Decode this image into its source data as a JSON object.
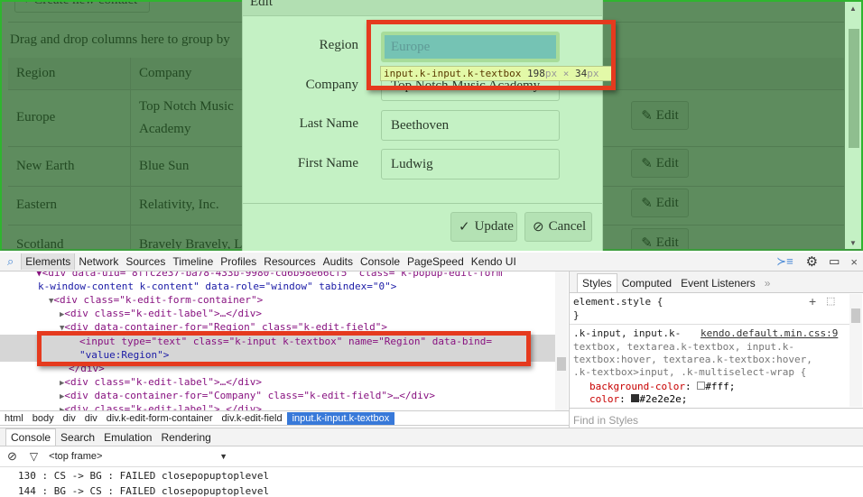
{
  "page": {
    "create_button": "Create new contact",
    "group_hint": "Drag and drop columns here to group by",
    "columns": [
      "Region",
      "Company"
    ],
    "rows": [
      {
        "region": "Europe",
        "company": "Top Notch Music Academy",
        "edit": "Edit"
      },
      {
        "region": "New Earth",
        "company": "Blue Sun",
        "edit": "Edit"
      },
      {
        "region": "Eastern",
        "company": "Relativity, Inc.",
        "edit": "Edit"
      },
      {
        "region": "Scotland",
        "company": "Bravely Bravely, LL",
        "edit": "Edit"
      }
    ]
  },
  "dialog": {
    "title": "Edit",
    "fields": [
      {
        "label": "Region",
        "value": "Europe"
      },
      {
        "label": "Company",
        "value": "Top Notch Music Academy"
      },
      {
        "label": "Last Name",
        "value": "Beethoven"
      },
      {
        "label": "First Name",
        "value": "Ludwig"
      }
    ],
    "update": "Update",
    "cancel": "Cancel",
    "tooltip": {
      "selector": "input.k-input.k-textbox",
      "width": "198",
      "height": "34",
      "unit": "px",
      "times": "×"
    }
  },
  "devtools": {
    "tabs": [
      "Elements",
      "Network",
      "Sources",
      "Timeline",
      "Profiles",
      "Resources",
      "Audits",
      "Console",
      "PageSpeed",
      "Kendo UI"
    ],
    "active_tab": "Elements",
    "dom": {
      "l0": "▼<div data-uid=\"8ffc2e37-ba78-433b-9980-cd6b98e66cf5\" class=\"k-popup-edit-form",
      "l0b": "k-window-content k-content\" data-role=\"window\" tabindex=\"0\">",
      "l1": "<div class=\"k-edit-form-container\">",
      "l2": "<div class=\"k-edit-label\">…</div>",
      "l3": "<div data-container-for=\"Region\" class=\"k-edit-field\">",
      "l4a": "<input type=\"text\" class=\"k-input k-textbox\" name=\"Region\" data-bind=",
      "l4b": "\"value:Region\">",
      "l5": "</div>",
      "l6": "<div class=\"k-edit-label\">…</div>",
      "l7": "<div data-container-for=\"Company\" class=\"k-edit-field\">…</div>",
      "l8": "<div class=\"k-edit-label\">…</div>"
    },
    "breadcrumbs": [
      "html",
      "body",
      "div",
      "div",
      "div.k-edit-form-container",
      "div.k-edit-field",
      "input.k-input.k-textbox"
    ],
    "drawer_tabs": [
      "Console",
      "Search",
      "Emulation",
      "Rendering"
    ],
    "frame": "<top frame>",
    "log": [
      "130 : CS -> BG : FAILED closepopuptoplevel",
      "144 : BG -> CS : FAILED closepopuptoplevel"
    ],
    "styles": {
      "tabs": [
        "Styles",
        "Computed",
        "Event Listeners"
      ],
      "more": "»",
      "element_style": "element.style {",
      "close_brace": "}",
      "rule_source": "kendo.default.min.css:9",
      "selector_1": ".k-input, input.k-",
      "selector_2": "textbox, textarea.k-textbox, input.k-",
      "selector_3": "textbox:hover, textarea.k-textbox:hover,",
      "selector_4": ".k-textbox>input, .k-multiselect-wrap {",
      "prop1": "background-color",
      "val1": "#fff",
      "prop2": "color",
      "val2": "#2e2e2e",
      "find_placeholder": "Find in Styles"
    }
  }
}
